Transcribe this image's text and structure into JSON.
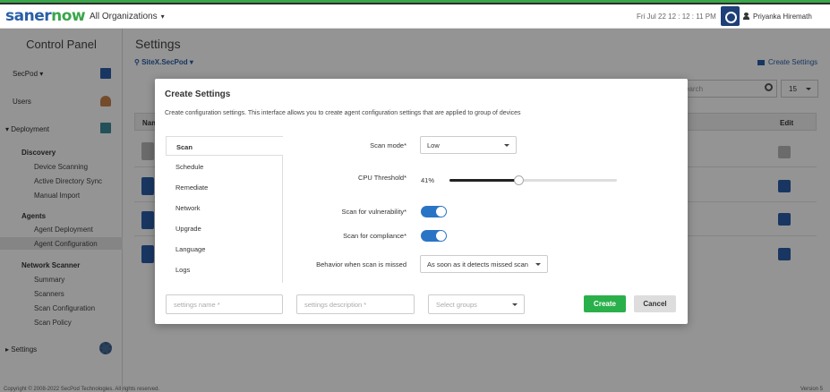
{
  "header": {
    "logo_left": "saner",
    "logo_right": "now",
    "organization": "All Organizations",
    "datetime": "Fri Jul 22  12 : 12 : 11 PM",
    "user_name": "Priyanka Hiremath"
  },
  "sidebar": {
    "title": "Control Panel",
    "secpod": "SecPod",
    "users": "Users",
    "deployment": "Deployment",
    "discovery": "Discovery",
    "discovery_items": [
      "Device Scanning",
      "Active Directory Sync",
      "Manual Import"
    ],
    "agents": "Agents",
    "agents_items": [
      "Agent Deployment",
      "Agent Configuration"
    ],
    "network_scanner": "Network Scanner",
    "network_items": [
      "Summary",
      "Scanners",
      "Scan Configuration",
      "Scan Policy"
    ],
    "settings": "Settings"
  },
  "main": {
    "title": "Settings",
    "site": "SiteX.SecPod",
    "create_settings": "Create Settings",
    "search_placeholder": "earch",
    "page_size": "15",
    "col_name": "Nam",
    "col_edit": "Edit"
  },
  "footer": {
    "copyright": "Copyright © 2008-2022 SecPod Technologies. All rights reserved.",
    "version": "Version 5"
  },
  "modal": {
    "title": "Create Settings",
    "description": "Create configuration settings. This interface allows you to create agent configuration settings that are applied to group of devices",
    "tabs": [
      "Scan",
      "Schedule",
      "Remediate",
      "Network",
      "Upgrade",
      "Language",
      "Logs"
    ],
    "scan_mode_label": "Scan mode*",
    "scan_mode_value": "Low",
    "cpu_label": "CPU Threshold*",
    "cpu_value": "41%",
    "cpu_fraction": 0.41,
    "vuln_label": "Scan for vulnerability*",
    "vuln_on": true,
    "compliance_label": "Scan for compliance*",
    "compliance_on": true,
    "missed_label": "Behavior when scan is missed",
    "missed_value": "As soon as it detects missed scan",
    "name_placeholder": "settings name *",
    "desc_placeholder": "settings description *",
    "groups_placeholder": "Select groups",
    "create": "Create",
    "cancel": "Cancel"
  },
  "colors": {
    "brand_blue": "#2a5ea8",
    "brand_green": "#3aa64a",
    "create_green": "#2ab04a",
    "toggle_blue": "#2a74c6"
  }
}
